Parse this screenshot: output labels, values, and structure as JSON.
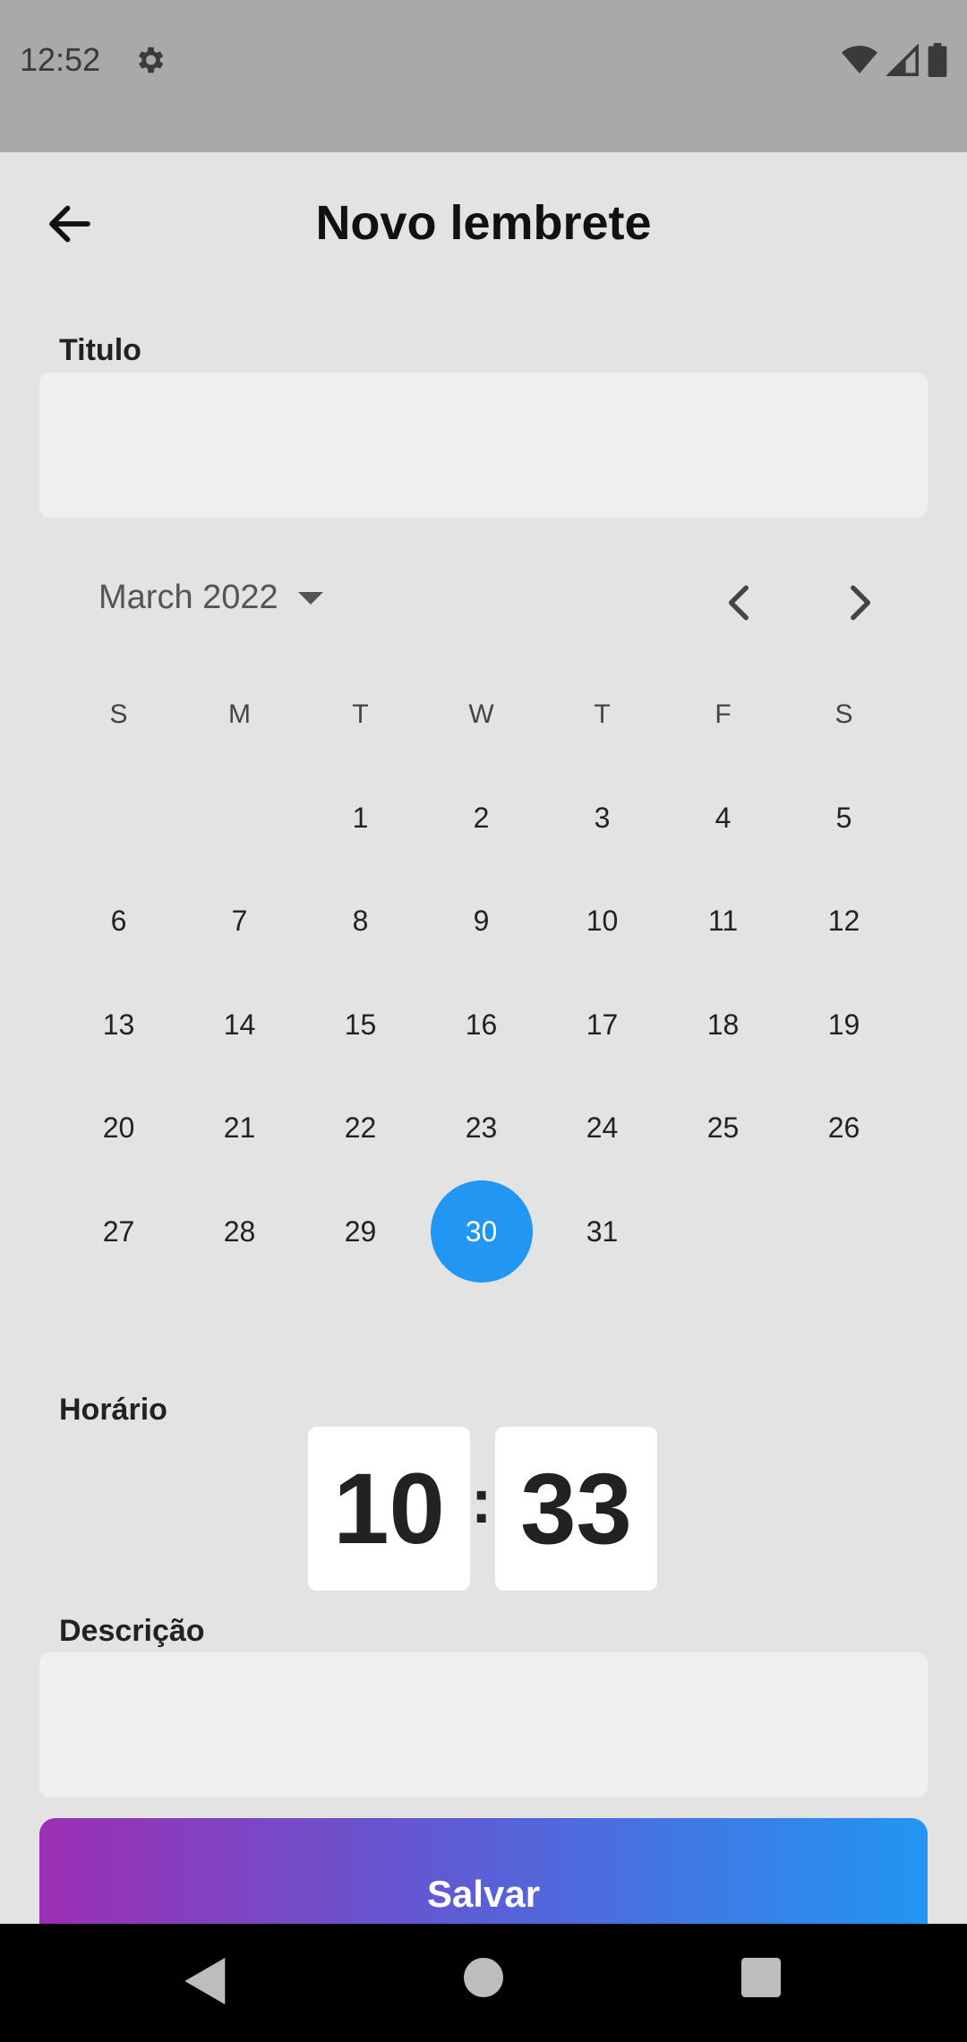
{
  "status_bar": {
    "time": "12:52"
  },
  "app_bar": {
    "title": "Novo lembrete"
  },
  "form": {
    "title_label": "Titulo",
    "title_value": "",
    "time_label": "Horário",
    "hour": "10",
    "minute": "33",
    "time_separator": ":",
    "description_label": "Descrição",
    "description_value": "",
    "save_label": "Salvar"
  },
  "calendar": {
    "month_label": "March 2022",
    "weekdays": [
      "S",
      "M",
      "T",
      "W",
      "T",
      "F",
      "S"
    ],
    "weeks": [
      [
        "",
        "",
        "1",
        "2",
        "3",
        "4",
        "5"
      ],
      [
        "6",
        "7",
        "8",
        "9",
        "10",
        "11",
        "12"
      ],
      [
        "13",
        "14",
        "15",
        "16",
        "17",
        "18",
        "19"
      ],
      [
        "20",
        "21",
        "22",
        "23",
        "24",
        "25",
        "26"
      ],
      [
        "27",
        "28",
        "29",
        "30",
        "31",
        "",
        ""
      ]
    ],
    "selected_day": "30",
    "selected_color": "#2196f3"
  },
  "colors": {
    "gradient_start": "#9b2fb3",
    "gradient_end": "#2196f3"
  },
  "icons": {
    "status": [
      "gear-icon",
      "wifi-icon",
      "signal-icon",
      "battery-icon"
    ],
    "app_bar": [
      "back-arrow-icon"
    ],
    "calendar": [
      "chevron-down-icon",
      "chevron-left-icon",
      "chevron-right-icon"
    ],
    "nav": [
      "nav-back-icon",
      "nav-home-icon",
      "nav-recent-icon"
    ]
  }
}
